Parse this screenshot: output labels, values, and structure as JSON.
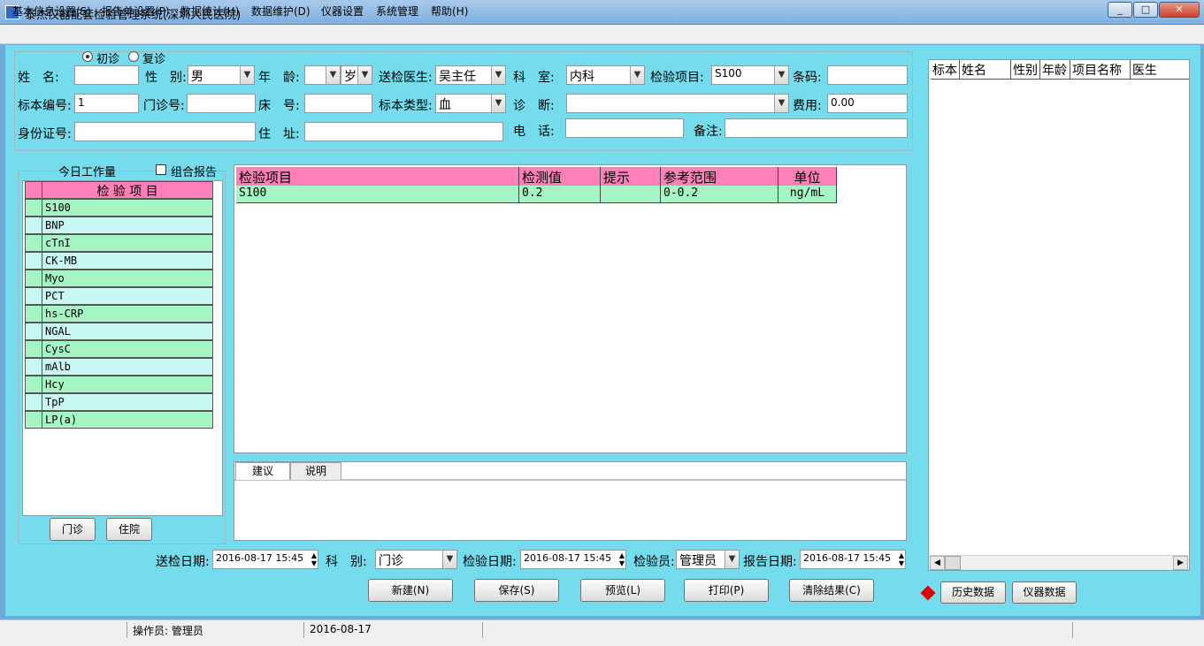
{
  "window": {
    "title": "泰杰仪器配套检验管理系统(深圳人民医院)",
    "min": "_",
    "max": "□",
    "close": "✕"
  },
  "menu": [
    "基本信息设置(S)",
    "报告单设置(P)",
    "数据统计(H)",
    "数据维护(D)",
    "仪器设置",
    "系统管理",
    "帮助(H)"
  ],
  "visit": {
    "first": "初诊",
    "return": "复诊",
    "selected": "first"
  },
  "form": {
    "name_label": "姓　名:",
    "name_value": "",
    "gender_label": "性　别:",
    "gender_value": "男",
    "age_label": "年　龄:",
    "age_value": "",
    "age_unit": "岁",
    "doctor_label": "送检医生:",
    "doctor_value": "吴主任",
    "dept_label": "科　室:",
    "dept_value": "内科",
    "item_label": "检验项目:",
    "item_value": "S100",
    "barcode_label": "条码:",
    "barcode_value": "",
    "specimen_no_label": "标本编号:",
    "specimen_no_value": "1",
    "outpatient_label": "门诊号:",
    "outpatient_value": "",
    "bed_label": "床　号:",
    "bed_value": "",
    "specimen_type_label": "标本类型:",
    "specimen_type_value": "血",
    "diagnosis_label": "诊　断:",
    "diagnosis_value": "",
    "fee_label": "费用:",
    "fee_value": "0.00",
    "id_label": "身份证号:",
    "id_value": "",
    "address_label": "住　址:",
    "address_value": "",
    "phone_label": "电　话:",
    "phone_value": "",
    "remark_label": "备注:",
    "remark_value": ""
  },
  "left": {
    "group_title": "今日工作量",
    "combo_label": "组合报告",
    "header": "检 验 项 目",
    "items": [
      "S100",
      "BNP",
      "cTnI",
      "CK-MB",
      "Myo",
      "PCT",
      "hs-CRP",
      "NGAL",
      "CysC",
      "mAlb",
      "Hcy",
      "TpP",
      "LP(a)"
    ],
    "btn_outpatient": "门诊",
    "btn_inpatient": "住院"
  },
  "results": {
    "headers": [
      "检验项目",
      "检测值",
      "提示",
      "参考范围",
      "单位"
    ],
    "rows": [
      {
        "item": "S100",
        "value": "0.2",
        "hint": "",
        "range": "0-0.2",
        "unit": "ng/mL"
      }
    ]
  },
  "tabs": [
    "建议",
    "说明"
  ],
  "bottom": {
    "send_date_label": "送检日期:",
    "send_date": "2016-08-17  15:45",
    "dept_label": "科　别:",
    "dept_value": "门诊",
    "test_date_label": "检验日期:",
    "test_date": "2016-08-17  15:45",
    "tester_label": "检验员:",
    "tester_value": "管理员",
    "report_date_label": "报告日期:",
    "report_date": "2016-08-17  15:45"
  },
  "actions": [
    "新建(N)",
    "保存(S)",
    "预览(L)",
    "打印(P)",
    "清除结果(C)"
  ],
  "right": {
    "headers": [
      "标本",
      "姓名",
      "性别",
      "年龄",
      "项目名称",
      "医生"
    ],
    "btn_history": "历史数据",
    "btn_instrument": "仪器数据"
  },
  "status": {
    "operator": "操作员: 管理员",
    "date": "2016-08-17"
  },
  "colors": {
    "background": "#74dcec",
    "header_pink": "#ff7fba",
    "row_green": "#a6f5c4",
    "row_cyan": "#c8f8f4",
    "marker_red": "#e00000"
  }
}
